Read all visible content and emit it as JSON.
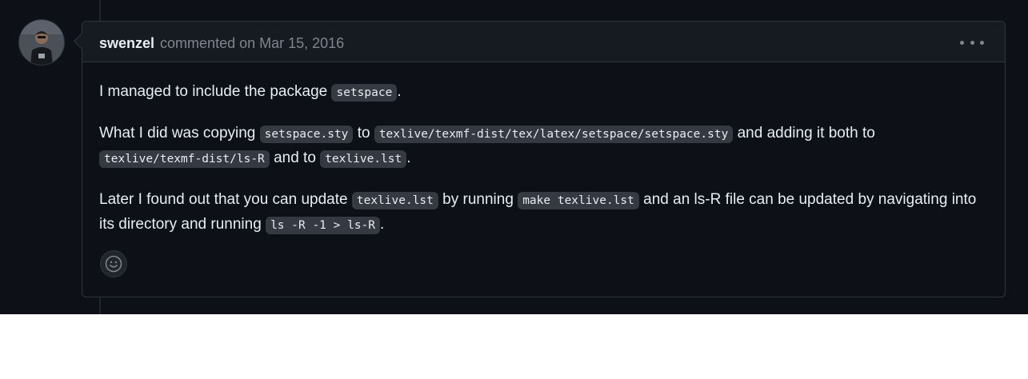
{
  "comment": {
    "author": "swenzel",
    "meta": "commented on Mar 15, 2016",
    "paragraphs": [
      [
        {
          "t": "text",
          "v": "I managed to include the package "
        },
        {
          "t": "code",
          "v": "setspace"
        },
        {
          "t": "text",
          "v": "."
        }
      ],
      [
        {
          "t": "text",
          "v": "What I did was copying "
        },
        {
          "t": "code",
          "v": "setspace.sty"
        },
        {
          "t": "text",
          "v": " to "
        },
        {
          "t": "code",
          "v": "texlive/texmf-dist/tex/latex/setspace/setspace.sty"
        },
        {
          "t": "text",
          "v": " and adding it both to "
        },
        {
          "t": "code",
          "v": "texlive/texmf-dist/ls-R"
        },
        {
          "t": "text",
          "v": " and to "
        },
        {
          "t": "code",
          "v": "texlive.lst"
        },
        {
          "t": "text",
          "v": "."
        }
      ],
      [
        {
          "t": "text",
          "v": "Later I found out that you can update "
        },
        {
          "t": "code",
          "v": "texlive.lst"
        },
        {
          "t": "text",
          "v": " by running "
        },
        {
          "t": "code",
          "v": "make texlive.lst"
        },
        {
          "t": "text",
          "v": " and an ls-R file can be updated by navigating into its directory and running "
        },
        {
          "t": "code",
          "v": "ls -R -1 > ls-R"
        },
        {
          "t": "text",
          "v": "."
        }
      ]
    ]
  },
  "icons": {
    "avatar": "user-avatar",
    "more": "kebab-horizontal-icon",
    "reaction": "smiley-icon"
  },
  "colors": {
    "background": "#0d1117",
    "header": "#161b22",
    "border": "#30363d",
    "text": "#e6edf3",
    "muted": "#7d8590",
    "code_bg": "#343942"
  }
}
